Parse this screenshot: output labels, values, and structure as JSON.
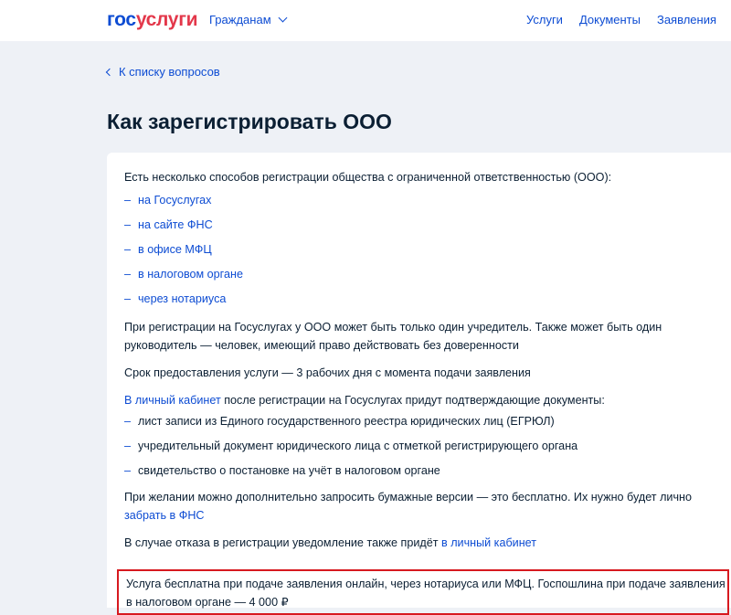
{
  "header": {
    "logo_part1": "гос",
    "logo_part2": "услуги",
    "citizen_menu": "Гражданам",
    "nav": [
      "Услуги",
      "Документы",
      "Заявления"
    ]
  },
  "back_link": "К списку вопросов",
  "page_title": "Как зарегистрировать ООО",
  "content": {
    "intro": "Есть несколько способов регистрации общества с ограниченной ответственностью (ООО):",
    "ways": [
      "на Госуслугах",
      "на сайте ФНС",
      "в офисе МФЦ",
      "в налоговом органе",
      "через нотариуса"
    ],
    "founder_note": "При регистрации на Госуслугах у ООО может быть только один учредитель. Также может быть один руководитель — человек, имеющий право действовать без доверенности",
    "term": "Срок предоставления услуги — 3 рабочих дня с момента подачи заявления",
    "docs_link": "В личный кабинет",
    "docs_intro_rest": " после регистрации на Госуслугах придут подтверждающие документы:",
    "docs": [
      "лист записи из Единого государственного реестра юридических лиц (ЕГРЮЛ)",
      "учредительный документ юридического лица с отметкой регистрирующего органа",
      "свидетельство о постановке на учёт в налоговом органе"
    ],
    "paper_text": "При желании можно дополнительно запросить бумажные версии — это бесплатно. Их нужно будет лично ",
    "paper_link": "забрать в ФНС",
    "refusal_text": "В случае отказа в регистрации уведомление также придёт ",
    "refusal_link": "в личный кабинет",
    "fee_line1": "Услуга бесплатна при подаче заявления онлайн, через нотариуса или МФЦ. Госпошлина при подаче заявления",
    "fee_line2": "в налоговом органе — 4 000 ₽"
  },
  "colors": {
    "brand_blue": "#0d4cd3",
    "brand_red": "#e3374a",
    "highlight_border": "#d7191f",
    "page_bg": "#eef1f6"
  }
}
